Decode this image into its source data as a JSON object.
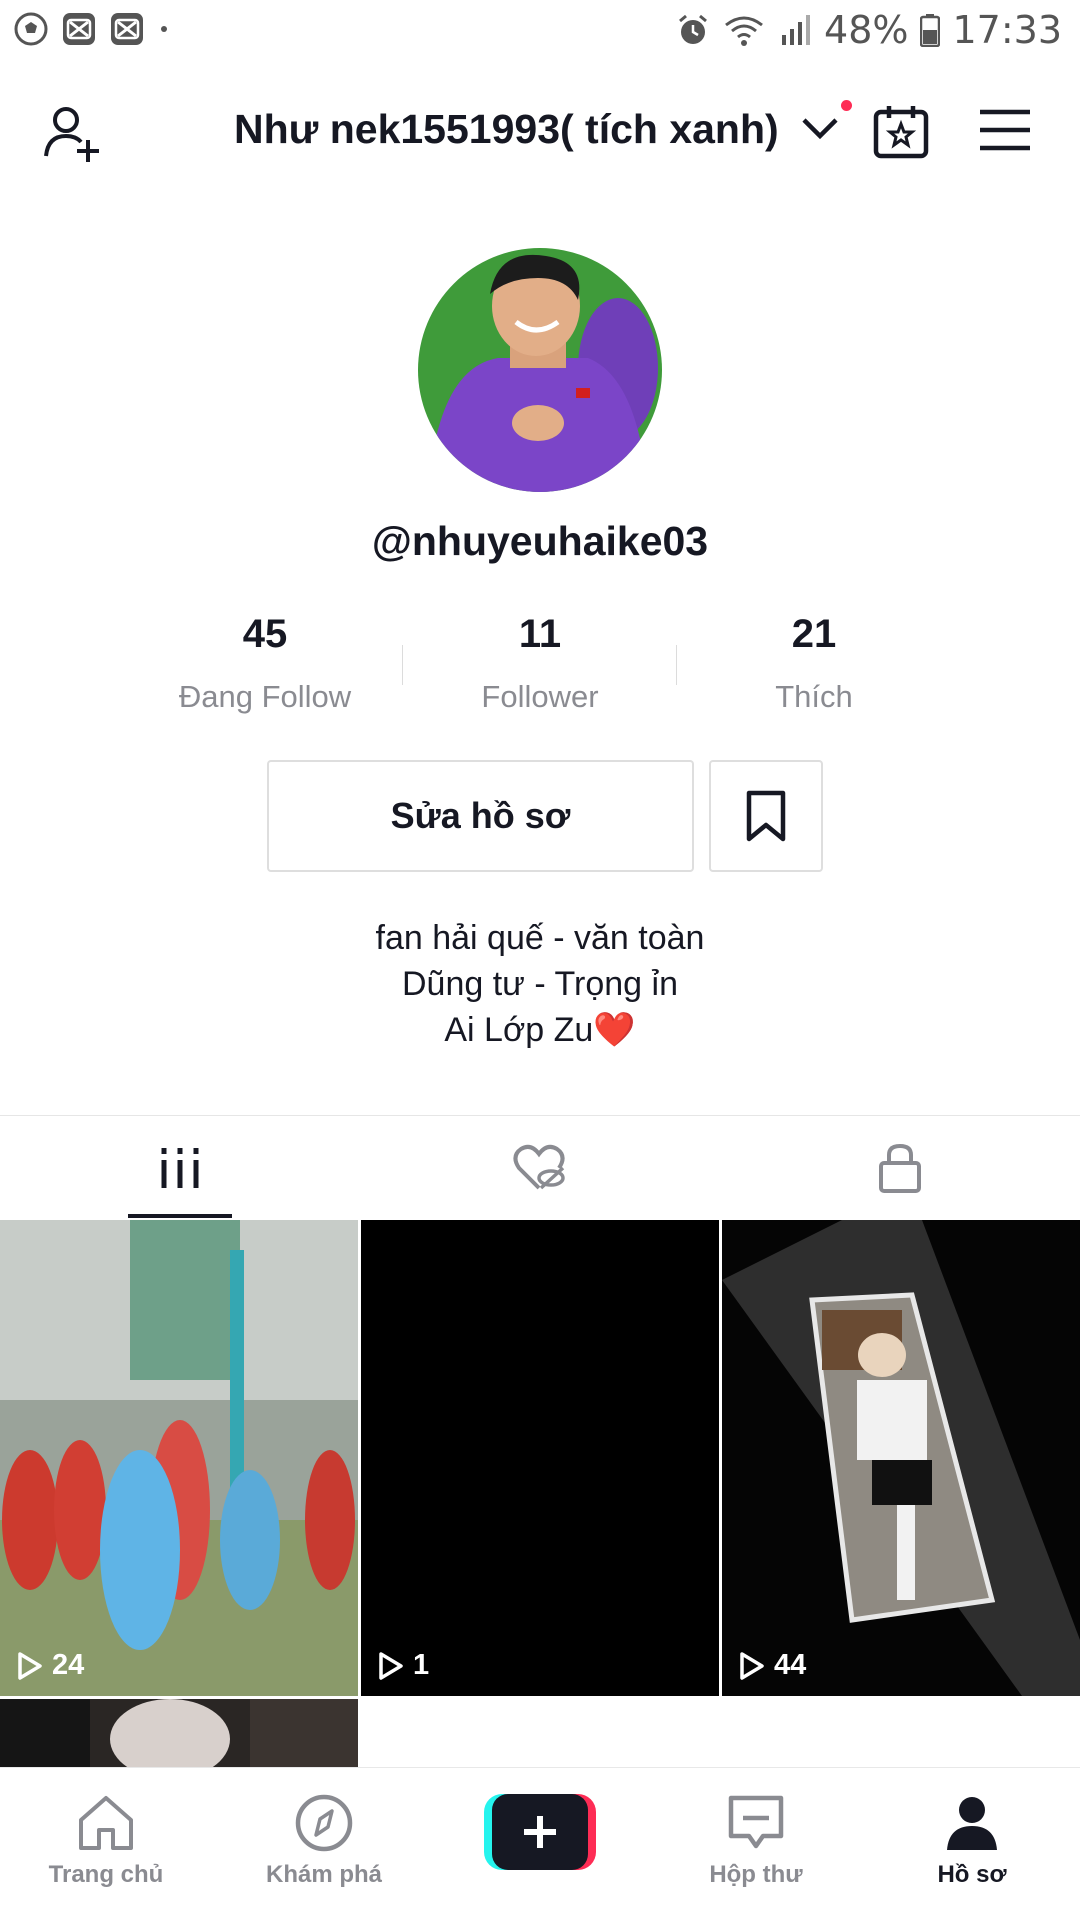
{
  "status_bar": {
    "battery": "48%",
    "time": "17:33",
    "left_icons": [
      "football-icon",
      "capcut-icon",
      "capcut-icon",
      "dot-icon"
    ],
    "right_icons": [
      "alarm-icon",
      "wifi-icon",
      "signal-icon",
      "battery-icon"
    ]
  },
  "header": {
    "title": "Như nek1551993( tích xanh)",
    "icons": [
      "add-user-icon",
      "chevron-down-icon",
      "notification-dot",
      "calendar-star-icon",
      "menu-icon"
    ],
    "notification_color": "#fe2c55"
  },
  "profile": {
    "username": "@nhuyeuhaike03",
    "stats": [
      {
        "value": "45",
        "label": "Đang Follow"
      },
      {
        "value": "11",
        "label": "Follower"
      },
      {
        "value": "21",
        "label": "Thích"
      }
    ],
    "edit_label": "Sửa hồ sơ",
    "bio": [
      "fan hải quế - văn toàn",
      "Dũng tư - Trọng ỉn",
      "Ai Lớp Zu❤️"
    ]
  },
  "tabs": {
    "items": [
      "videos-grid-icon",
      "liked-hidden-icon",
      "private-lock-icon"
    ],
    "active": 0
  },
  "videos": [
    {
      "views": "24",
      "style": "photo"
    },
    {
      "views": "1",
      "style": "black"
    },
    {
      "views": "44",
      "style": "photo"
    },
    {
      "views": "",
      "style": "photo"
    }
  ],
  "bottom_nav": {
    "items": [
      {
        "label": "Trang chủ",
        "icon": "home-icon"
      },
      {
        "label": "Khám phá",
        "icon": "compass-icon"
      },
      {
        "label": "",
        "icon": "plus-icon"
      },
      {
        "label": "Hộp thư",
        "icon": "inbox-icon"
      },
      {
        "label": "Hồ sơ",
        "icon": "profile-icon"
      }
    ],
    "active": 4
  }
}
